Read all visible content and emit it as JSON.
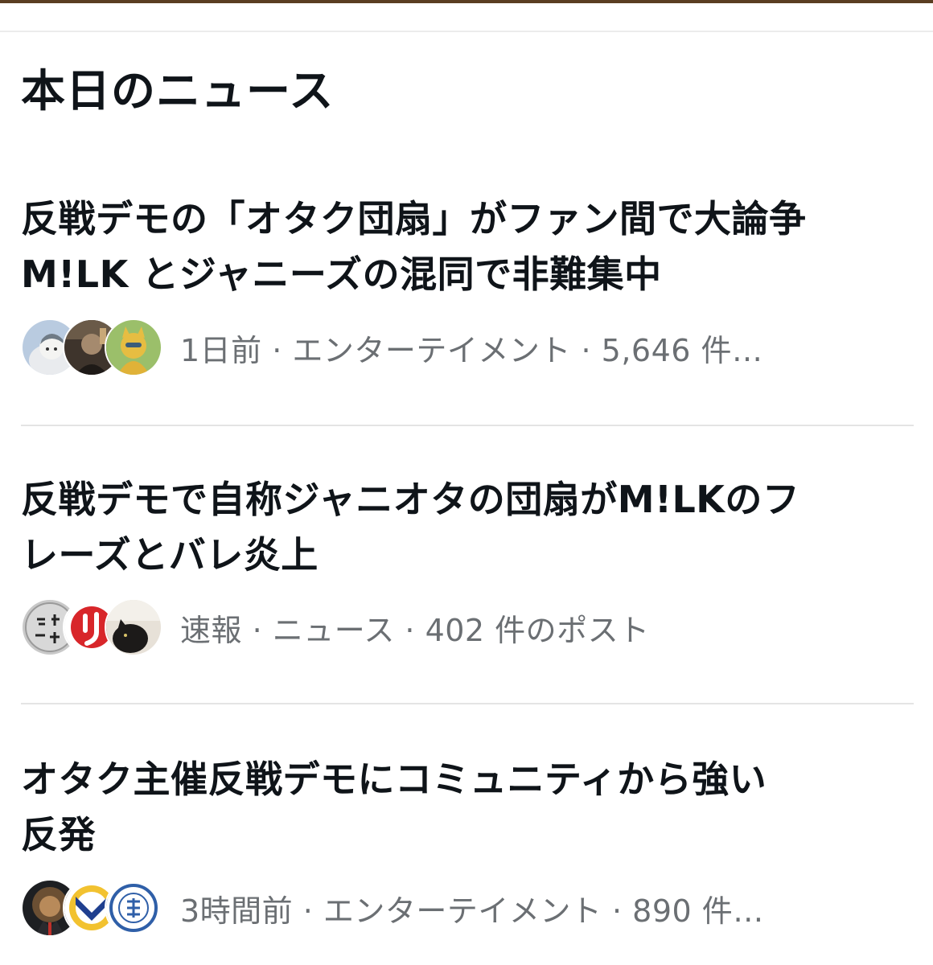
{
  "section_title": "本日のニュース",
  "news": [
    {
      "headline_lines": [
        "反戦デモの「オタク団扇」がファン間で大論争",
        "M!LK とジャニーズの混同で非難集中"
      ],
      "meta": "1日前 · エンターテイメント · 5,646 件…",
      "avatars": [
        "avatar-illustration-white-cat-icon",
        "avatar-photo-person-icon",
        "avatar-yellow-fox-cartoon-icon"
      ]
    },
    {
      "headline_lines": [
        "反戦デモで自称ジャニオタの団扇がM!LKのフ",
        "レーズとバレ炎上"
      ],
      "meta": "速報 · ニュース · 402 件のポスト",
      "avatars": [
        "avatar-kanji-stamp-icon",
        "avatar-red-logo-icon",
        "avatar-photo-cat-icon"
      ]
    },
    {
      "headline_lines": [
        "オタク主催反戦デモにコミュニティから強い",
        "反発"
      ],
      "meta": "3時間前 · エンターテイメント · 890 件…",
      "avatars": [
        "avatar-lion-portrait-icon",
        "avatar-blue-yellow-logo-icon",
        "avatar-blue-seal-icon"
      ]
    }
  ],
  "colors": {
    "top_bar": "#5a3e22",
    "meta_text": "#6b6f73",
    "divider": "#e4e4e4"
  }
}
